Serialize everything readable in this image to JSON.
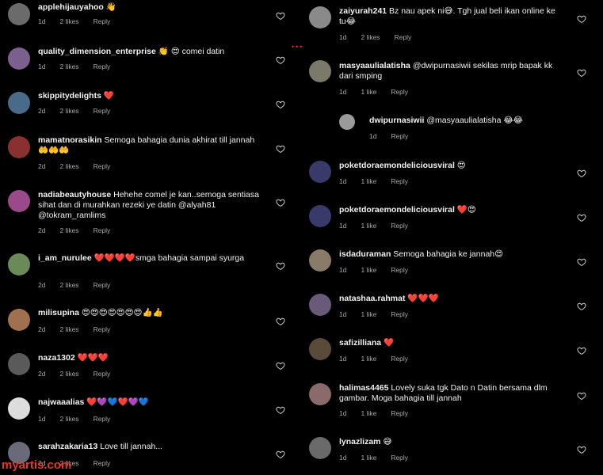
{
  "left": [
    {
      "user": "applehijauyahoo",
      "text": "👋",
      "time": "1d",
      "likes": "2 likes",
      "reply": "Reply",
      "avatar_color": "#6b6b6b"
    },
    {
      "user": "quality_dimension_enterprise",
      "text": "👏 😍 comei datin",
      "time": "1d",
      "likes": "2 likes",
      "reply": "Reply",
      "avatar_color": "#7a5f8f"
    },
    {
      "user": "skippitydelights",
      "text": "❤️",
      "time": "2d",
      "likes": "2 likes",
      "reply": "Reply",
      "avatar_color": "#4a6a8a"
    },
    {
      "user": "mamatnorasikin",
      "text": "Semoga bahagia dunia akhirat till jannah🤲🤲🤲",
      "time": "2d",
      "likes": "2 likes",
      "reply": "Reply",
      "avatar_color": "#8a3030"
    },
    {
      "user": "nadiabeautyhouse",
      "text": "Hehehe comel je kan..semoga sentiasa sihat dan di murahkan rezeki ye datin @alyah81 @tokram_ramlims",
      "time": "2d",
      "likes": "2 likes",
      "reply": "Reply",
      "avatar_color": "#9a4a8a"
    },
    {
      "user": "i_am_nurulee",
      "text": "❤️❤️❤️❤️smga bahagia sampai syurga",
      "time": "2d",
      "likes": "2 likes",
      "reply": "Reply",
      "avatar_color": "#6a8a5a"
    },
    {
      "user": "milisupina",
      "text": "😍😍😍😍😍😍😍👍👍",
      "time": "2d",
      "likes": "2 likes",
      "reply": "Reply",
      "avatar_color": "#a07050"
    },
    {
      "user": "naza1302",
      "text": "❤️❤️❤️",
      "time": "2d",
      "likes": "2 likes",
      "reply": "Reply",
      "avatar_color": "#5a5a5a"
    },
    {
      "user": "najwaaalias",
      "text": "❤️💜💙❤️💜💙",
      "time": "1d",
      "likes": "2 likes",
      "reply": "Reply",
      "avatar_color": "#dddddd"
    },
    {
      "user": "sarahzakaria13",
      "text": "Love till jannah...",
      "time": "2d",
      "likes": "2 likes",
      "reply": "Reply",
      "avatar_color": "#6a6a7a"
    }
  ],
  "right": [
    {
      "user": "zaiyurah241",
      "text": "Bz nau apek ni😅. Tgh jual beli ikan online ke tu😂",
      "time": "1d",
      "likes": "2 likes",
      "reply": "Reply",
      "avatar_color": "#8a8a8a"
    },
    {
      "user": "masyaaulialatisha",
      "text": "@dwipurnasiwii  sekilas mrip bapak kk dari smping",
      "time": "1d",
      "likes": "1 like",
      "reply": "Reply",
      "avatar_color": "#7a7a6a"
    },
    {
      "user": "dwipurnasiwii",
      "text": "@masyaaulialatisha 😂😂",
      "time": "1d",
      "likes": "",
      "reply": "Reply",
      "avatar_color": "#9a9a9a"
    },
    {
      "user": "poketdoraemondeliciousviral",
      "text": "😍",
      "time": "1d",
      "likes": "1 like",
      "reply": "Reply",
      "avatar_color": "#3a3a6a"
    },
    {
      "user": "poketdoraemondeliciousviral",
      "text": "❤️😍",
      "time": "1d",
      "likes": "1 like",
      "reply": "Reply",
      "avatar_color": "#3a3a6a"
    },
    {
      "user": "isdaduraman",
      "text": "Semoga bahagia ke jannah😍",
      "time": "1d",
      "likes": "1 like",
      "reply": "Reply",
      "avatar_color": "#8a7a6a"
    },
    {
      "user": "natashaa.rahmat",
      "text": "❤️❤️❤️",
      "time": "1d",
      "likes": "1 like",
      "reply": "Reply",
      "avatar_color": "#6a5a7a"
    },
    {
      "user": "safizilliana",
      "text": "❤️",
      "time": "1d",
      "likes": "1 like",
      "reply": "Reply",
      "avatar_color": "#5a4a3a"
    },
    {
      "user": "halimas4465",
      "text": "Lovely suka tgk Dato n Datin bersama dlm gambar. Moga bahagia till jannah",
      "time": "1d",
      "likes": "1 like",
      "reply": "Reply",
      "avatar_color": "#8a6a6a"
    },
    {
      "user": "lynazlizam",
      "text": "😅",
      "time": "1d",
      "likes": "1 like",
      "reply": "Reply",
      "avatar_color": "#6a6a6a"
    }
  ],
  "watermark": "myartis.com",
  "accent": "#e6392b"
}
